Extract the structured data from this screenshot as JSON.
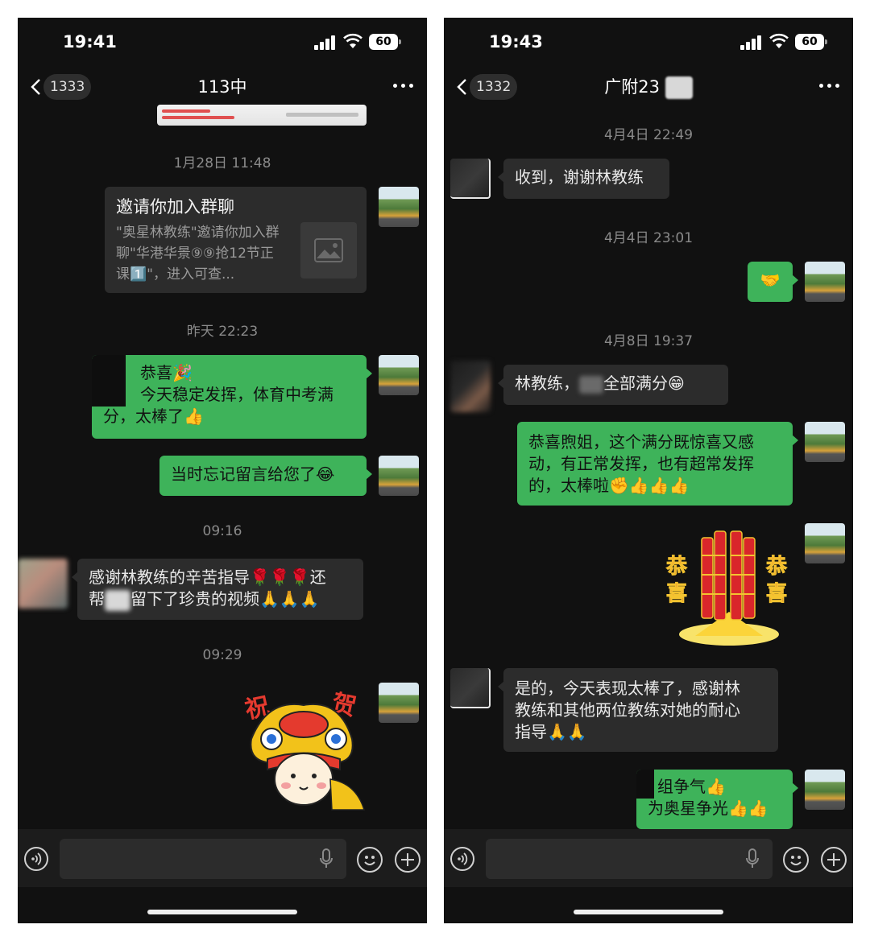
{
  "left": {
    "status": {
      "time": "19:41",
      "battery": "60"
    },
    "nav": {
      "unread": "1333",
      "title": "113中"
    },
    "messages": {
      "t1": "1月28日 11:48",
      "invite": {
        "title": "邀请你加入群聊",
        "desc": "\"奥星林教练\"邀请你加入群聊\"华港华景⑨⑨抢12节正课1️⃣\"，进入可查..."
      },
      "t2": "昨天 22:23",
      "m1_line1": "恭喜🎉",
      "m1_line2": "今天稳定发挥，体育中考满",
      "m1_line3": "分，太棒了👍",
      "m2": "当时忘记留言给您了😂",
      "t3": "09:16",
      "m3_line1": "感谢林教练的辛苦指导🌹🌹🌹还",
      "m3_line2_a": "帮",
      "m3_line2_b": "留下了珍贵的视频🙏🙏🙏",
      "t4": "09:29",
      "sticker_text": [
        "祝",
        "贺"
      ]
    }
  },
  "right": {
    "status": {
      "time": "19:43",
      "battery": "60"
    },
    "nav": {
      "unread": "1332",
      "title": "广附23"
    },
    "messages": {
      "t1": "4月4日 22:49",
      "m1": "收到，谢谢林教练",
      "t2": "4月4日 23:01",
      "m2": "🤝",
      "t3": "4月8日 19:37",
      "m3_a": "林教练，",
      "m3_b": "全部满分😁",
      "m4_line1": "恭喜煦姐，这个满分既惊喜又感",
      "m4_line2": "动，有正常发挥，也有超常发挥",
      "m4_line3": "的，太棒啦✊👍👍👍",
      "sticker_text": [
        "恭",
        "喜",
        "恭",
        "喜"
      ],
      "m5_line1": "是的，今天表现太棒了，感谢林",
      "m5_line2": "教练和其他两位教练对她的耐心",
      "m5_line3": "指导🙏🙏",
      "m6_line1": "组争气👍",
      "m6_line2": "为奥星争光👍👍"
    }
  },
  "colors": {
    "my_bubble": "#3eb35a",
    "other_bubble": "#2c2c2c",
    "background": "#111111"
  }
}
